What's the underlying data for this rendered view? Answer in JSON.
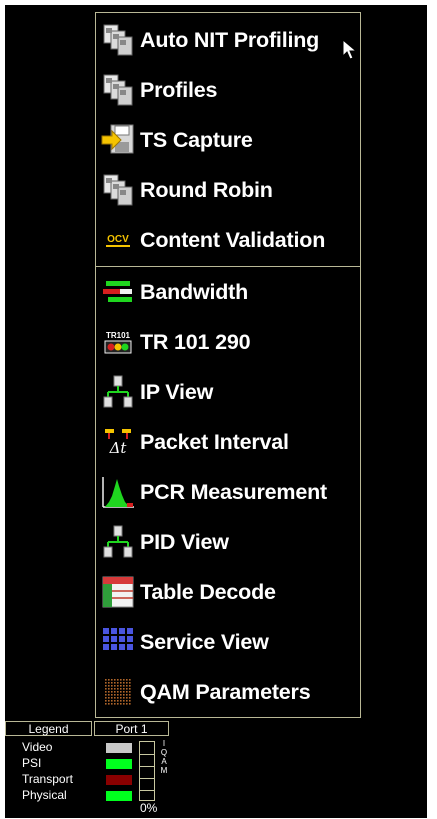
{
  "menu": {
    "items": [
      {
        "label": "Auto NIT Profiling",
        "icon": "documents-stack-icon"
      },
      {
        "label": "Profiles",
        "icon": "documents-stack-icon"
      },
      {
        "label": "TS Capture",
        "icon": "floppy-arrow-icon"
      },
      {
        "label": "Round Robin",
        "icon": "documents-stack-icon"
      },
      {
        "label": "Content Validation",
        "icon": "ocv-icon"
      },
      {
        "label": "Bandwidth",
        "icon": "bandwidth-bars-icon"
      },
      {
        "label": "TR 101 290",
        "icon": "tr101-traffic-light-icon"
      },
      {
        "label": "IP View",
        "icon": "tree-hierarchy-icon"
      },
      {
        "label": "Packet Interval",
        "icon": "delta-t-icon"
      },
      {
        "label": "PCR Measurement",
        "icon": "histogram-icon"
      },
      {
        "label": "PID View",
        "icon": "tree-hierarchy-icon"
      },
      {
        "label": "Table Decode",
        "icon": "table-icon"
      },
      {
        "label": "Service View",
        "icon": "grid-dots-icon"
      },
      {
        "label": "QAM Parameters",
        "icon": "constellation-icon"
      }
    ],
    "ocv_text": "OCV",
    "tr101_text": "TR101",
    "delta_t_text": "Δt"
  },
  "legend": {
    "tab": "Legend",
    "port_tab": "Port 1",
    "rows": [
      {
        "label": "Video",
        "color": "#c8c8c8"
      },
      {
        "label": "PSI",
        "color": "#00ff1e"
      },
      {
        "label": "Transport",
        "color": "#8a0000"
      },
      {
        "label": "Physical",
        "color": "#00ff1e"
      }
    ],
    "meter_letters": [
      "I",
      "Q",
      "A",
      "M"
    ],
    "percent": "0%"
  },
  "colors": {
    "border": "#b9b896",
    "background": "#000000",
    "text": "#ffffff",
    "accent_yellow": "#f5c400",
    "accent_green": "#1fd61f",
    "accent_red": "#d61f1f"
  }
}
